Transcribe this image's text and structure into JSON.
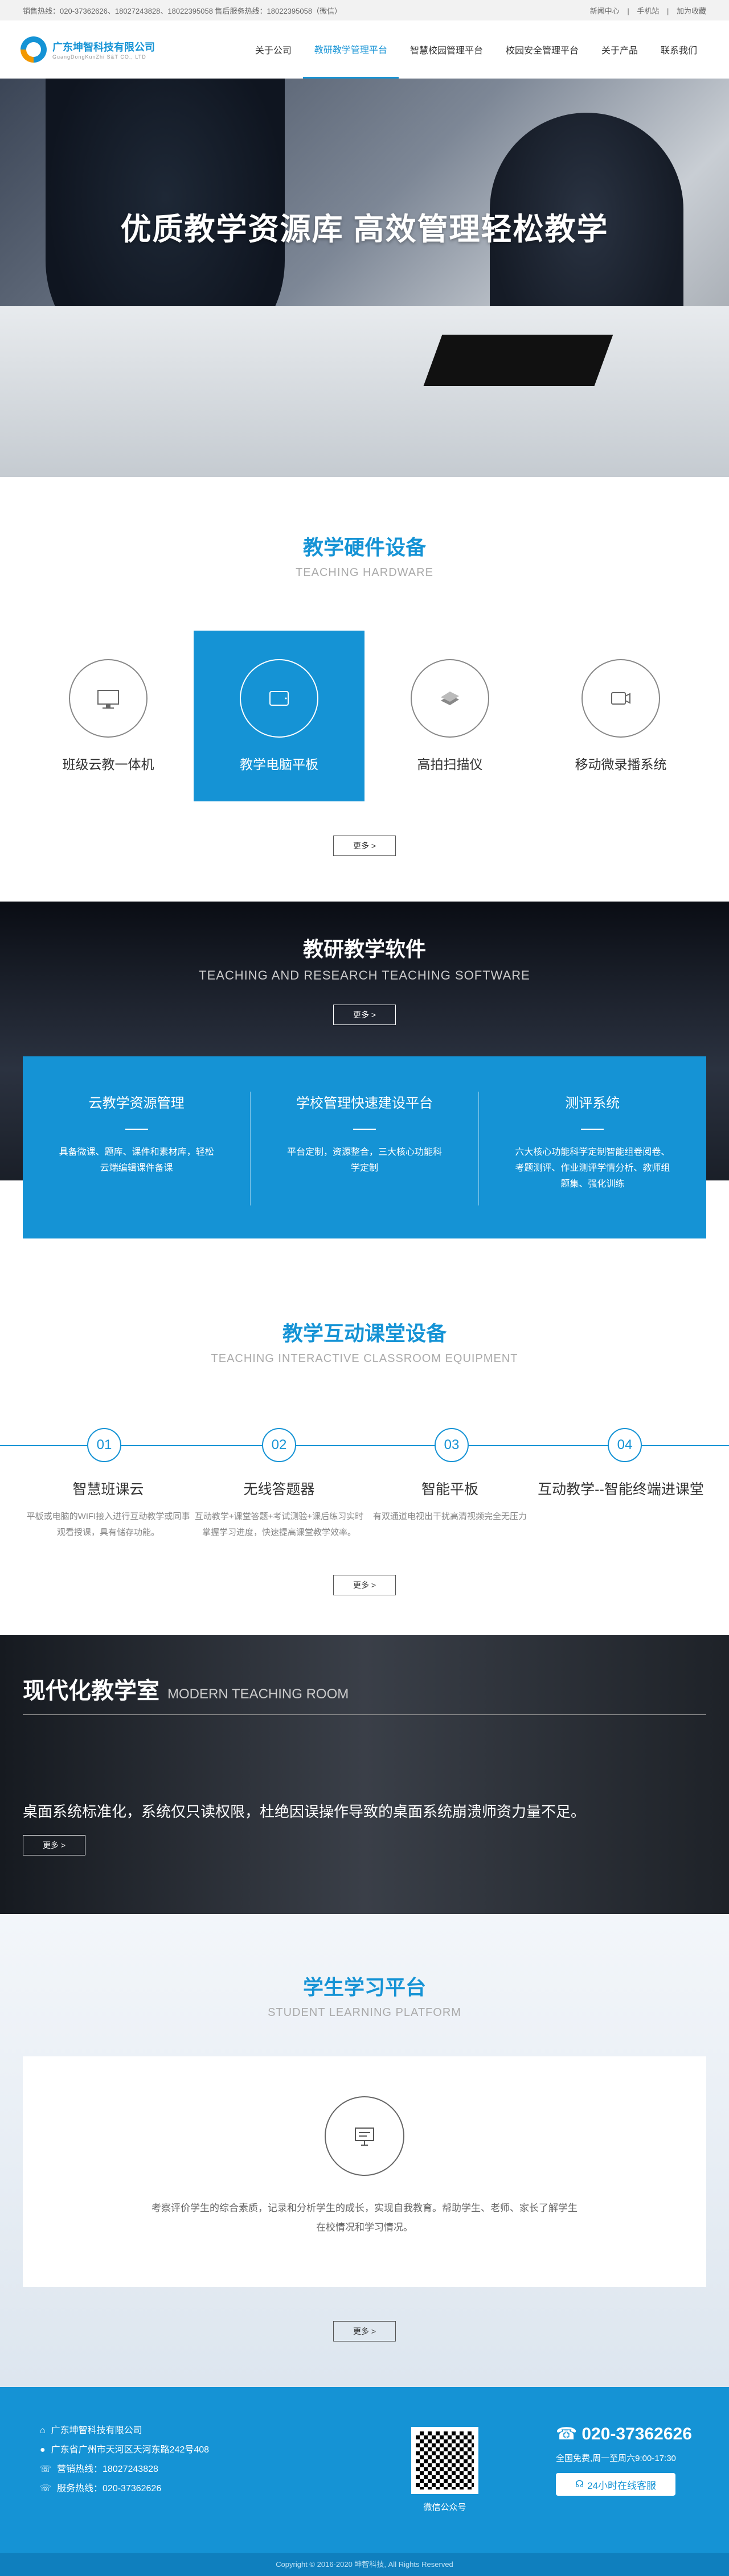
{
  "topbar": {
    "left": "销售热线：020-37362626、18027243828、18022395058   售后服务热线：18022395058（微信）",
    "links": [
      "新闻中心",
      "手机站",
      "加为收藏"
    ]
  },
  "logo": {
    "cn": "广东坤智科技有限公司",
    "en": "GuangDongKunZhi S&T CO., LTD"
  },
  "nav": [
    "关于公司",
    "教研教学管理平台",
    "智慧校园管理平台",
    "校园安全管理平台",
    "关于产品",
    "联系我们"
  ],
  "hero": {
    "title": "优质教学资源库  高效管理轻松教学"
  },
  "hardware": {
    "title": "教学硬件设备",
    "subtitle": "TEACHING HARDWARE",
    "items": [
      "班级云教一体机",
      "教学电脑平板",
      "高拍扫描仪",
      "移动微录播系统"
    ],
    "more": "更多 >"
  },
  "software": {
    "title": "教研教学软件",
    "subtitle": "TEACHING AND RESEARCH TEACHING SOFTWARE",
    "more": "更多 >",
    "cols": [
      {
        "title": "云教学资源管理",
        "desc": "具备微课、题库、课件和素材库，轻松云端编辑课件备课"
      },
      {
        "title": "学校管理快速建设平台",
        "desc": "平台定制，资源整合，三大核心功能科学定制"
      },
      {
        "title": "测评系统",
        "desc": "六大核心功能科学定制智能组卷阅卷、考题测评、作业测评学情分析、教师组题集、强化训练"
      }
    ]
  },
  "interactive": {
    "title": "教学互动课堂设备",
    "subtitle": "TEACHING INTERACTIVE CLASSROOM EQUIPMENT",
    "steps": [
      {
        "num": "01",
        "title": "智慧班课云",
        "desc": "平板或电脑的WIFI接入进行互动教学或同事观看授课，具有储存功能。"
      },
      {
        "num": "02",
        "title": "无线答题器",
        "desc": "互动教学+课堂答题+考试测验+课后练习实时掌握学习进度，快速提高课堂教学效率。"
      },
      {
        "num": "03",
        "title": "智能平板",
        "desc": "有双通道电视出干扰高清视频完全无压力"
      },
      {
        "num": "04",
        "title": "互动教学--智能终端进课堂",
        "desc": ""
      }
    ],
    "more": "更多 >"
  },
  "modern": {
    "title": "现代化教学室",
    "subtitle": "MODERN TEACHING ROOM",
    "desc": "桌面系统标准化，系统仅只读权限，杜绝因误操作导致的桌面系统崩溃师资力量不足。",
    "more": "更多 >"
  },
  "student": {
    "title": "学生学习平台",
    "subtitle": "STUDENT LEARNING PLATFORM",
    "desc": "考察评价学生的综合素质，记录和分析学生的成长，实现自我教育。帮助学生、老师、家长了解学生在校情况和学习情况。",
    "more": "更多 >"
  },
  "footer": {
    "company": "广东坤智科技有限公司",
    "address": "广东省广州市天河区天河东路242号408",
    "sales": "营销热线：18027243828",
    "hotline": "服务热线：020-37362626",
    "qr_label": "微信公众号",
    "phone": "020-37362626",
    "hours": "全国免费,周一至周六9:00-17:30",
    "online": "24小时在线客服",
    "copyright": "Copyright © 2016-2020 坤智科技, All Rights Reserved"
  },
  "colors": {
    "accent": "#1593d5"
  }
}
